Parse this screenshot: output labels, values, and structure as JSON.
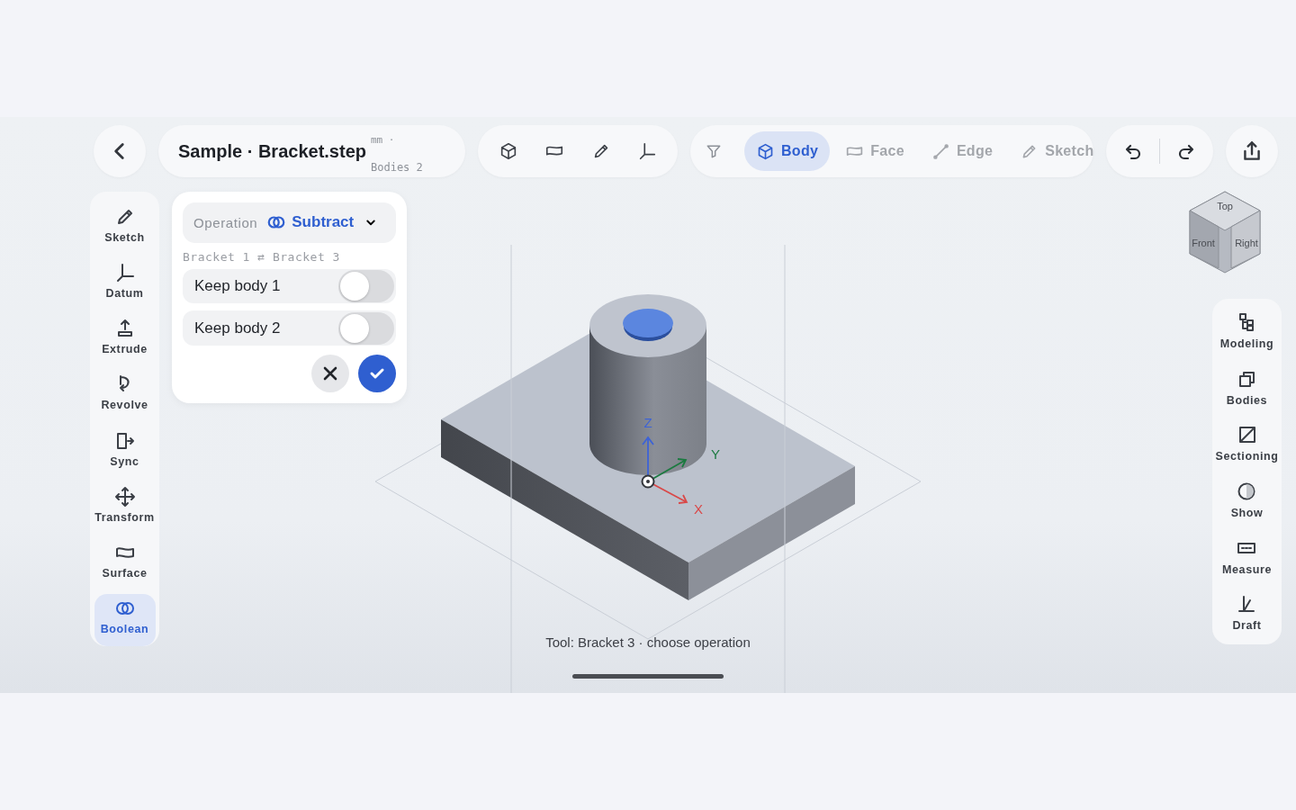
{
  "file": {
    "title": "Sample · Bracket.step",
    "unit": "mm ·",
    "meta": "Bodies 2"
  },
  "view_tools": [
    {
      "kind": "cube"
    },
    {
      "kind": "plane"
    },
    {
      "kind": "pencil"
    },
    {
      "kind": "axes"
    }
  ],
  "selection_filter": [
    {
      "label": "Body",
      "kind": "cube",
      "selected": true
    },
    {
      "label": "Face",
      "kind": "plane",
      "selected": false
    },
    {
      "label": "Edge",
      "kind": "edge",
      "selected": false
    },
    {
      "label": "Sketch",
      "kind": "pencil",
      "selected": false
    }
  ],
  "left_tools": [
    {
      "label": "Sketch",
      "kind": "pencil",
      "selected": false
    },
    {
      "label": "Datum",
      "kind": "axes",
      "selected": false
    },
    {
      "label": "Extrude",
      "kind": "extrude",
      "selected": false
    },
    {
      "label": "Revolve",
      "kind": "revolve",
      "selected": false
    },
    {
      "label": "Sync",
      "kind": "sync",
      "selected": false
    },
    {
      "label": "Transform",
      "kind": "transform",
      "selected": false
    },
    {
      "label": "Surface",
      "kind": "surface",
      "selected": false
    },
    {
      "label": "Boolean",
      "kind": "boolean",
      "selected": true
    }
  ],
  "boolean_panel": {
    "operation_label": "Operation",
    "operation": "Subtract",
    "bodies": "Bracket 1 ⇄ Bracket 3",
    "options": [
      {
        "label": "Keep body 1",
        "on": false
      },
      {
        "label": "Keep body 2",
        "on": false
      }
    ]
  },
  "view_cube": {
    "top": "Top",
    "front": "Front",
    "right": "Right"
  },
  "right_tools": [
    {
      "label": "Modeling",
      "kind": "tree"
    },
    {
      "label": "Bodies",
      "kind": "bodies"
    },
    {
      "label": "Sectioning",
      "kind": "section"
    },
    {
      "label": "Show",
      "kind": "show"
    },
    {
      "label": "Measure",
      "kind": "measure"
    },
    {
      "label": "Draft",
      "kind": "draft"
    }
  ],
  "viewport": {
    "axes": [
      {
        "label": "Z",
        "kind": "z"
      },
      {
        "label": "Y",
        "kind": "y"
      },
      {
        "label": "X",
        "kind": "x"
      }
    ],
    "status": "Tool: Bracket 3 · choose operation"
  }
}
